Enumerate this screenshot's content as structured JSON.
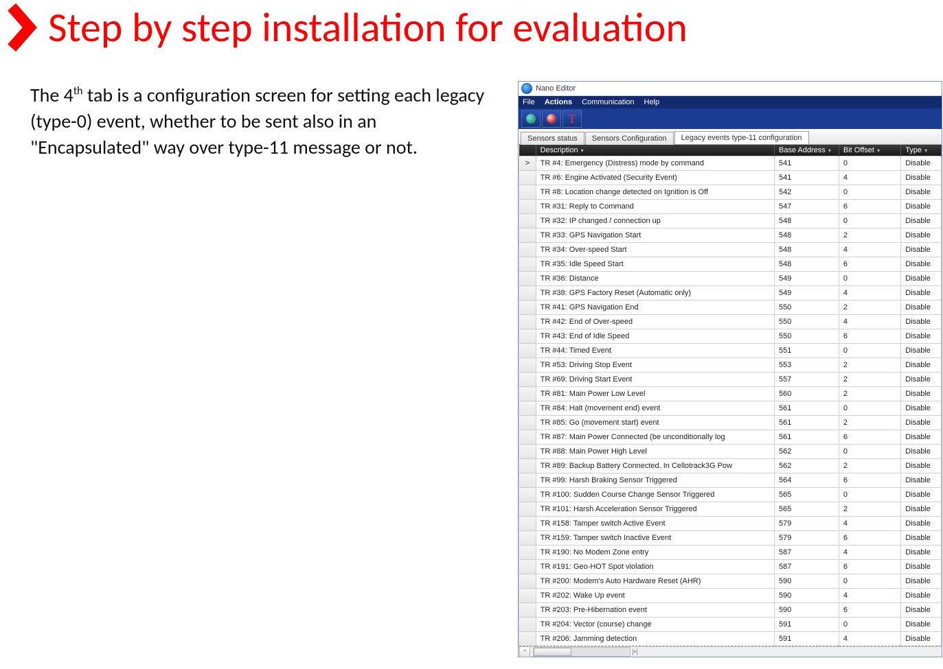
{
  "slide": {
    "title": "Step by step installation for evaluation",
    "paragraph_html": "The 4<sup>th</sup> tab is a configuration screen for setting each legacy (type-0) event, whether to be sent also in an \"Encapsulated\" way over type-11 message or not."
  },
  "window": {
    "title": "Nano Editor",
    "menu": [
      "File",
      "Actions",
      "Communication",
      "Help"
    ],
    "tabs": [
      {
        "label": "Sensors status",
        "active": false
      },
      {
        "label": "Sensors Configuration",
        "active": false
      },
      {
        "label": "Legacy events type-11 configuration",
        "active": true
      }
    ],
    "columns": [
      "Description",
      "Base Address",
      "Bit Offset",
      "Type"
    ],
    "rows": [
      {
        "desc": "TR #4: Emergency (Distress) mode by command",
        "base": "541",
        "bit": "0",
        "type": "Disable",
        "sel": true
      },
      {
        "desc": "TR #6: Engine Activated (Security Event)",
        "base": "541",
        "bit": "4",
        "type": "Disable"
      },
      {
        "desc": "TR #8: Location change detected on Ignition is Off",
        "base": "542",
        "bit": "0",
        "type": "Disable"
      },
      {
        "desc": "TR #31: Reply to Command",
        "base": "547",
        "bit": "6",
        "type": "Disable"
      },
      {
        "desc": "TR #32: IP changed / connection up",
        "base": "548",
        "bit": "0",
        "type": "Disable"
      },
      {
        "desc": "TR #33: GPS Navigation Start",
        "base": "548",
        "bit": "2",
        "type": "Disable"
      },
      {
        "desc": "TR #34: Over-speed Start",
        "base": "548",
        "bit": "4",
        "type": "Disable"
      },
      {
        "desc": "TR #35: Idle Speed Start",
        "base": "548",
        "bit": "6",
        "type": "Disable"
      },
      {
        "desc": "TR #36: Distance",
        "base": "549",
        "bit": "0",
        "type": "Disable"
      },
      {
        "desc": "TR #38: GPS Factory Reset (Automatic only)",
        "base": "549",
        "bit": "4",
        "type": "Disable"
      },
      {
        "desc": "TR #41: GPS Navigation End",
        "base": "550",
        "bit": "2",
        "type": "Disable"
      },
      {
        "desc": "TR #42: End of Over-speed",
        "base": "550",
        "bit": "4",
        "type": "Disable"
      },
      {
        "desc": "TR #43: End of Idle Speed",
        "base": "550",
        "bit": "6",
        "type": "Disable"
      },
      {
        "desc": "TR #44: Timed Event",
        "base": "551",
        "bit": "0",
        "type": "Disable"
      },
      {
        "desc": "TR #53: Driving Stop Event",
        "base": "553",
        "bit": "2",
        "type": "Disable"
      },
      {
        "desc": "TR #69: Driving Start Event",
        "base": "557",
        "bit": "2",
        "type": "Disable"
      },
      {
        "desc": "TR #81: Main Power Low Level",
        "base": "560",
        "bit": "2",
        "type": "Disable"
      },
      {
        "desc": "TR #84: Halt (movement end) event",
        "base": "561",
        "bit": "0",
        "type": "Disable"
      },
      {
        "desc": "TR #85: Go (movement start) event",
        "base": "561",
        "bit": "2",
        "type": "Disable"
      },
      {
        "desc": "TR #87: Main Power Connected (be unconditionally log",
        "base": "561",
        "bit": "6",
        "type": "Disable"
      },
      {
        "desc": "TR #88: Main Power High Level",
        "base": "562",
        "bit": "0",
        "type": "Disable"
      },
      {
        "desc": "TR #89: Backup Battery Connected. In Cellotrack3G Pow",
        "base": "562",
        "bit": "2",
        "type": "Disable"
      },
      {
        "desc": "TR #99: Harsh Braking Sensor Triggered",
        "base": "564",
        "bit": "6",
        "type": "Disable"
      },
      {
        "desc": "TR #100: Sudden Course Change Sensor Triggered",
        "base": "565",
        "bit": "0",
        "type": "Disable"
      },
      {
        "desc": "TR #101: Harsh Acceleration Sensor Triggered",
        "base": "565",
        "bit": "2",
        "type": "Disable"
      },
      {
        "desc": "TR #158: Tamper switch Active Event",
        "base": "579",
        "bit": "4",
        "type": "Disable"
      },
      {
        "desc": "TR #159: Tamper switch Inactive Event",
        "base": "579",
        "bit": "6",
        "type": "Disable"
      },
      {
        "desc": "TR #190: No Modem Zone entry",
        "base": "587",
        "bit": "4",
        "type": "Disable"
      },
      {
        "desc": "TR #191: Geo-HOT Spot violation",
        "base": "587",
        "bit": "6",
        "type": "Disable"
      },
      {
        "desc": "TR #200: Modem's Auto Hardware Reset (AHR)",
        "base": "590",
        "bit": "0",
        "type": "Disable"
      },
      {
        "desc": "TR #202: Wake Up event",
        "base": "590",
        "bit": "4",
        "type": "Disable"
      },
      {
        "desc": "TR #203: Pre-Hibernation event",
        "base": "590",
        "bit": "6",
        "type": "Disable"
      },
      {
        "desc": "TR #204: Vector (course) change",
        "base": "591",
        "bit": "0",
        "type": "Disable"
      },
      {
        "desc": "TR #206: Jamming detection",
        "base": "591",
        "bit": "4",
        "type": "Disable",
        "cut": true
      }
    ]
  }
}
